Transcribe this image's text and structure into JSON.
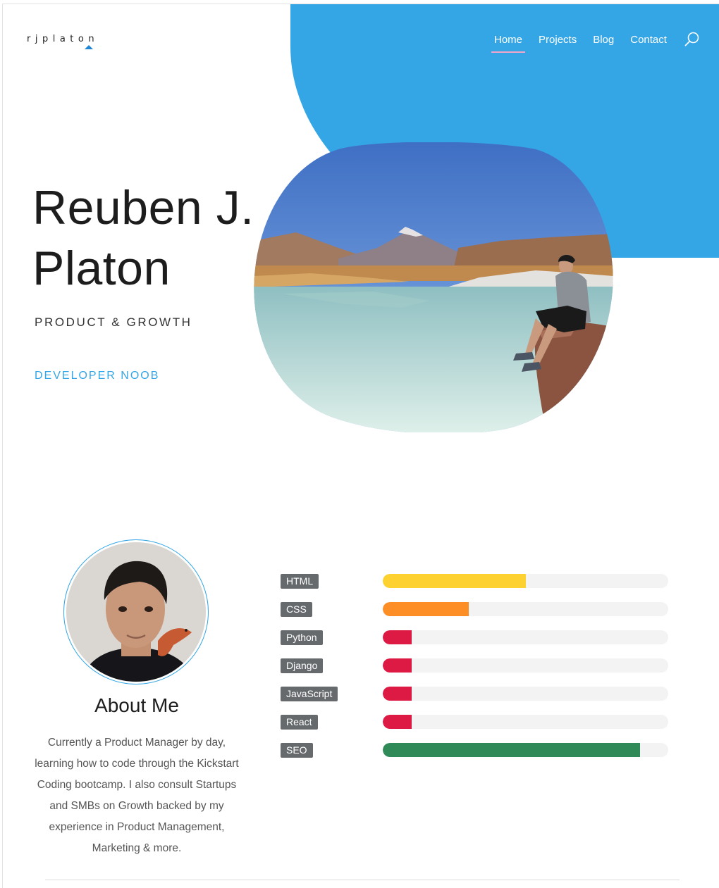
{
  "header": {
    "logo": "rjplaton",
    "nav": [
      "Home",
      "Projects",
      "Blog",
      "Contact"
    ],
    "active_nav": "Home",
    "accent": "#35a6e5"
  },
  "hero": {
    "name_line1": "Reuben J.",
    "name_line2": "Platon",
    "tagline": "PRODUCT & GROWTH",
    "subtag": "DEVELOPER NOOB"
  },
  "about": {
    "title": "About Me",
    "text": "Currently a Product Manager by day, learning how to code through the Kickstart Coding bootcamp. I also consult Startups and SMBs on Growth backed by my experience in Product Management, Marketing & more."
  },
  "skills": [
    {
      "label": "HTML",
      "level": 0.5,
      "color": "#fdd230"
    },
    {
      "label": "CSS",
      "level": 0.3,
      "color": "#fd8d25"
    },
    {
      "label": "Python",
      "level": 0.1,
      "color": "#dc1a44"
    },
    {
      "label": "Django",
      "level": 0.1,
      "color": "#dc1a44"
    },
    {
      "label": "JavaScript",
      "level": 0.1,
      "color": "#dc1a44"
    },
    {
      "label": "React",
      "level": 0.1,
      "color": "#dc1a44"
    },
    {
      "label": "SEO",
      "level": 0.9,
      "color": "#2f8a57"
    }
  ]
}
